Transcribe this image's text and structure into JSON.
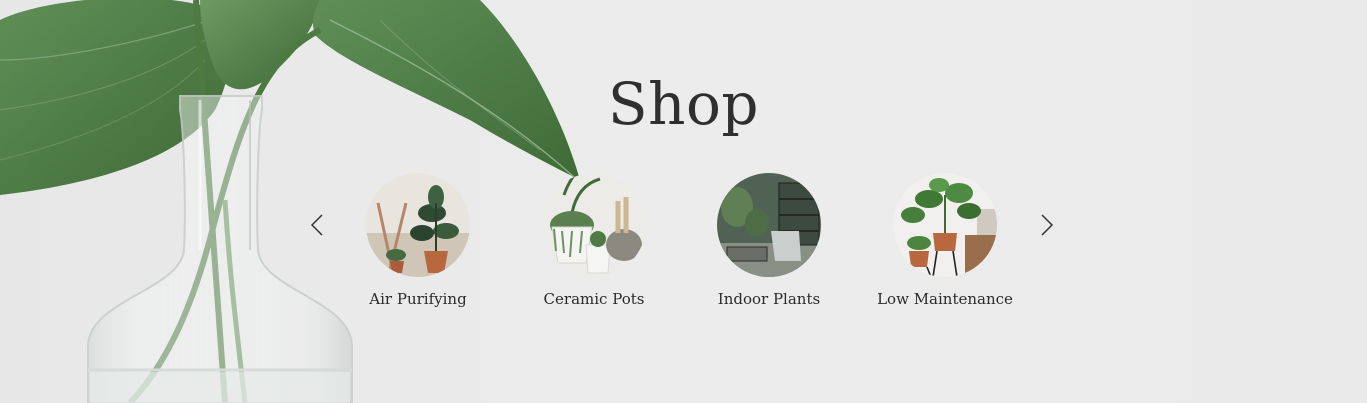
{
  "hero": {
    "title": "Shop",
    "background_color": "#ebebeb",
    "image": "plant-in-glass-vase-photo"
  },
  "carousel": {
    "prev_icon": "chevron-left-icon",
    "next_icon": "chevron-right-icon",
    "items": [
      {
        "label": "Air Purifying",
        "image": "rubber-plant-photo"
      },
      {
        "label": "Ceramic Pots",
        "image": "ceramic-pots-photo"
      },
      {
        "label": "Indoor Plants",
        "image": "indoor-room-plants-photo"
      },
      {
        "label": "Low Maintenance",
        "image": "potted-plants-on-stands-photo"
      }
    ]
  },
  "colors": {
    "text": "#2f2f2f",
    "leaf": "#4f7d45",
    "pot": "#b8673f"
  }
}
